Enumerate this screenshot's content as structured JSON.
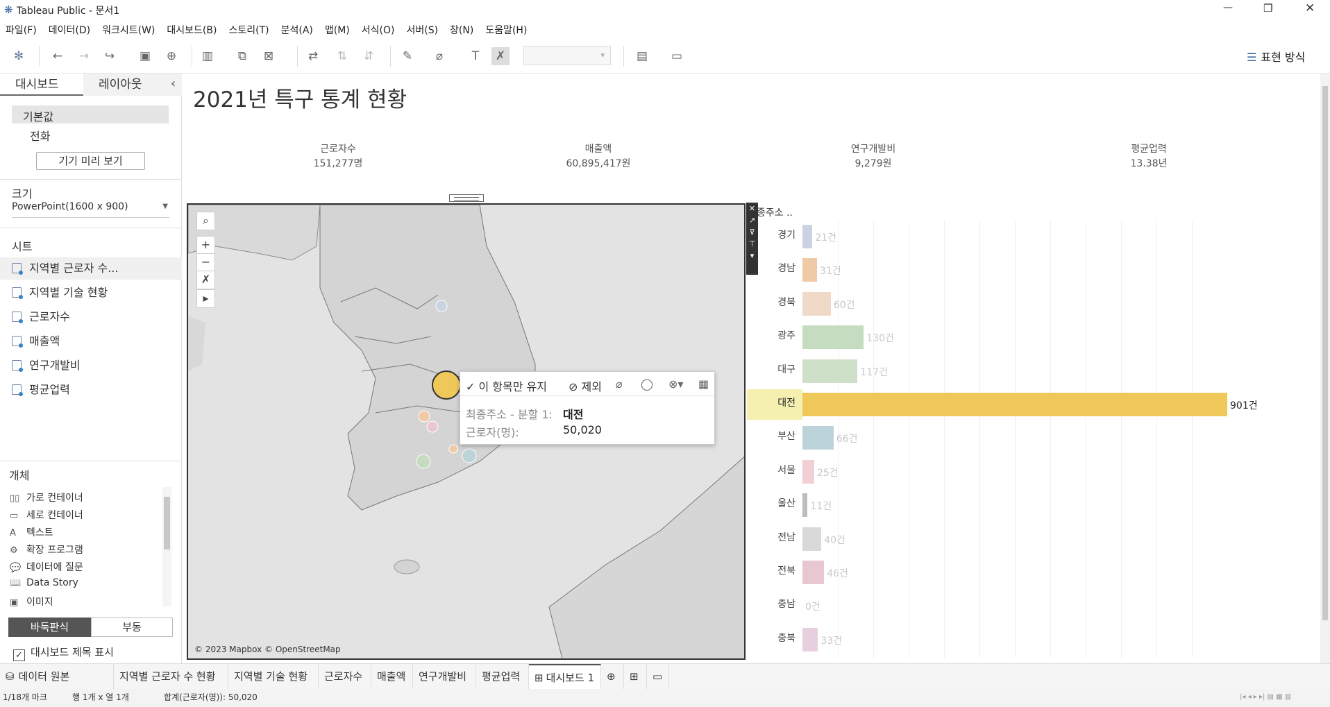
{
  "app": {
    "title": "Tableau Public - 문서1"
  },
  "window_controls": {
    "minimize": "—",
    "maximize": "❐",
    "close": "✕"
  },
  "menu": [
    "파일(F)",
    "데이터(D)",
    "워크시트(W)",
    "대시보드(B)",
    "스토리(T)",
    "분석(A)",
    "맵(M)",
    "서식(O)",
    "서버(S)",
    "창(N)",
    "도움말(H)"
  ],
  "toolbar": {
    "show_me_label": "표현 방식"
  },
  "left_panel": {
    "tabs": [
      "대시보드",
      "레이아웃"
    ],
    "collapse_glyph": "‹",
    "device_default": "기본값",
    "device_phone": "전화",
    "device_preview_button": "기기 미리 보기",
    "size_title": "크기",
    "size_value": "PowerPoint(1600 x 900)",
    "sheets_title": "시트",
    "sheets": [
      "지역별 근로자 수...",
      "지역별 기술 현황",
      "근로자수",
      "매출액",
      "연구개발비",
      "평균업력"
    ],
    "objects_title": "개체",
    "objects": [
      {
        "icon": "horizontal-container-icon",
        "glyph": "▯▯",
        "label": "가로 컨테이너"
      },
      {
        "icon": "vertical-container-icon",
        "glyph": "▭",
        "label": "세로 컨테이너"
      },
      {
        "icon": "text-icon",
        "glyph": "A",
        "label": "텍스트"
      },
      {
        "icon": "extension-icon",
        "glyph": "⚙",
        "label": "확장 프로그램"
      },
      {
        "icon": "ask-data-icon",
        "glyph": "💬",
        "label": "데이터에 질문"
      },
      {
        "icon": "data-story-icon",
        "glyph": "📖",
        "label": "Data Story"
      },
      {
        "icon": "image-icon",
        "glyph": "▣",
        "label": "이미지"
      }
    ],
    "layout_tiled": "바둑판식",
    "layout_floating": "부동",
    "show_title_check": "대시보드 제목 표시"
  },
  "dashboard": {
    "title": "2021년 특구 통계 현황",
    "kpis": [
      {
        "label": "근로자수",
        "value": "151,277명"
      },
      {
        "label": "매출액",
        "value": "60,895,417원"
      },
      {
        "label": "연구개발비",
        "value": "9,279원"
      },
      {
        "label": "평균업력",
        "value": "13.38년"
      }
    ],
    "map": {
      "attribution": "© 2023 Mapbox © OpenStreetMap"
    },
    "tooltip": {
      "keep_only": "✓ 이 항목만 유지",
      "exclude": "⊘ 제외",
      "field_label": "최종주소 - 분할 1:",
      "field_value": "대전",
      "measure_label": "근로자(명):",
      "measure_value": "50,020"
    },
    "bar_header": "종주소 .."
  },
  "chart_data": {
    "type": "bar",
    "orientation": "horizontal",
    "categories": [
      "경기",
      "경남",
      "경북",
      "광주",
      "대구",
      "대전",
      "부산",
      "서울",
      "울산",
      "전남",
      "전북",
      "충남",
      "충북"
    ],
    "values": [
      21,
      31,
      60,
      130,
      117,
      901,
      66,
      25,
      11,
      40,
      46,
      0,
      33
    ],
    "labels": [
      "21건",
      "31건",
      "60건",
      "130건",
      "117건",
      "901건",
      "66건",
      "25건",
      "11건",
      "40건",
      "46건",
      "0건",
      "33건"
    ],
    "colors": [
      "#c9d3e2",
      "#f0c9a6",
      "#f1d9c8",
      "#c6dcc0",
      "#cfe0c8",
      "#efc85a",
      "#bcd3d9",
      "#f2cfd4",
      "#bdbdbd",
      "#d9d9d9",
      "#e8c7d1",
      "#dddddd",
      "#e8cfe0"
    ],
    "highlighted": "대전",
    "xlim": [
      0,
      901
    ]
  },
  "sheet_tabs": [
    "데이터 원본",
    "지역별 근로자 수 현황",
    "지역별 기술 현황",
    "근로자수",
    "매출액",
    "연구개발비",
    "평균업력",
    "대시보드 1"
  ],
  "status": {
    "marks": "1/18개 마크",
    "rows_cols": "행 1개  x  열 1개",
    "sum": "합계(근로자(명)): 50,020"
  }
}
